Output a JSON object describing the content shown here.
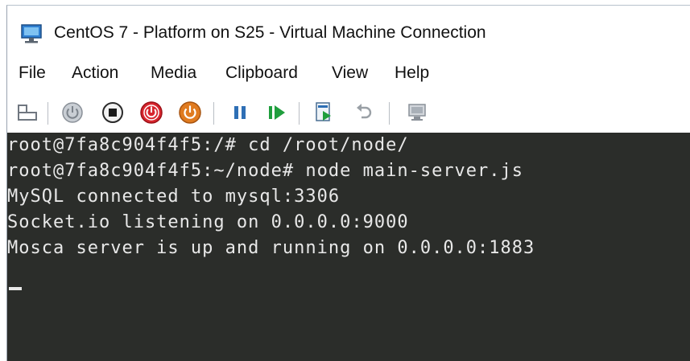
{
  "window": {
    "title": "CentOS 7 - Platform on S25 - Virtual Machine Connection"
  },
  "menu": {
    "items": [
      "File",
      "Action",
      "Media",
      "Clipboard",
      "View",
      "Help"
    ]
  },
  "toolbar": {
    "icons": [
      "ctrl-alt-del-icon",
      "start-icon",
      "turn-off-icon",
      "shut-down-icon",
      "power-icon",
      "pause-icon",
      "resume-icon",
      "checkpoint-icon",
      "revert-icon",
      "enhanced-session-icon"
    ],
    "colors": {
      "stop_red": "#d7262e",
      "power_orange": "#e07b1f",
      "play_blue": "#2e6fb5",
      "play_green": "#1f9e3d"
    }
  },
  "terminal": {
    "lines": [
      "root@7fa8c904f4f5:/# cd /root/node/",
      "root@7fa8c904f4f5:~/node# node main-server.js",
      "MySQL connected to mysql:3306",
      "Socket.io listening on 0.0.0.0:9000",
      "Mosca server is up and running on 0.0.0.0:1883"
    ],
    "background": "#2b2d2a",
    "foreground": "#e8e8e8"
  }
}
